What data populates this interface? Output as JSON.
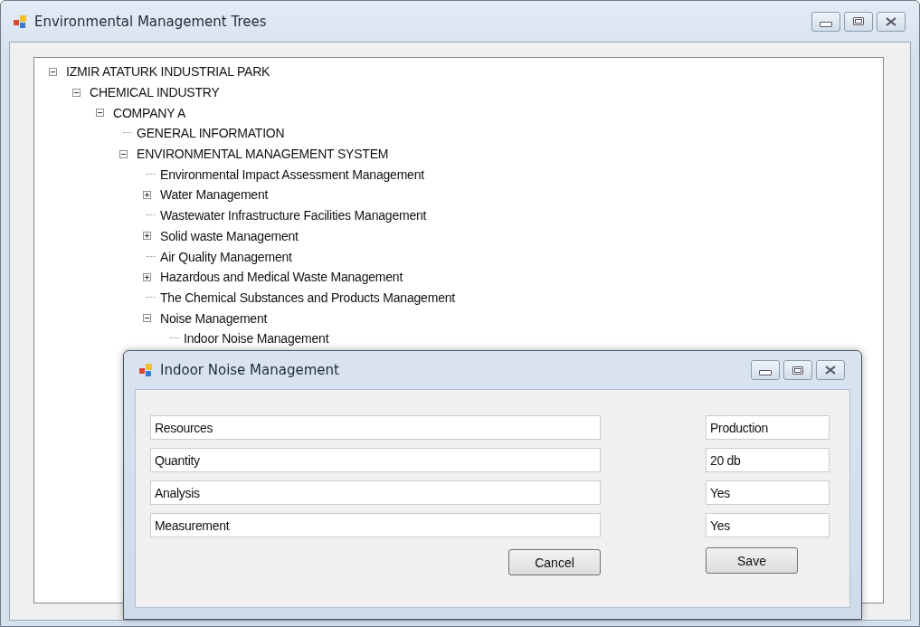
{
  "window": {
    "title": "Environmental Management Trees"
  },
  "tree": {
    "nodes": [
      {
        "label": "IZMIR ATATURK INDUSTRIAL PARK",
        "expanded": true,
        "children": [
          {
            "label": "CHEMICAL INDUSTRY",
            "expanded": true,
            "children": [
              {
                "label": "COMPANY A",
                "expanded": true,
                "children": [
                  {
                    "label": "GENERAL INFORMATION"
                  },
                  {
                    "label": "ENVIRONMENTAL MANAGEMENT SYSTEM",
                    "expanded": true,
                    "children": [
                      {
                        "label": "Environmental Impact Assessment Management"
                      },
                      {
                        "label": "Water Management",
                        "expanded": false
                      },
                      {
                        "label": "Wastewater Infrastructure Facilities Management"
                      },
                      {
                        "label": "Solid waste Management",
                        "expanded": false
                      },
                      {
                        "label": "Air Quality Management"
                      },
                      {
                        "label": "Hazardous and Medical Waste Management",
                        "expanded": false
                      },
                      {
                        "label": "The Chemical Substances and Products Management"
                      },
                      {
                        "label": "Noise Management",
                        "expanded": true,
                        "children": [
                          {
                            "label": "Indoor Noise Management"
                          }
                        ]
                      }
                    ]
                  }
                ]
              }
            ]
          }
        ]
      }
    ]
  },
  "dialog": {
    "title": "Indoor Noise Management",
    "rows": [
      {
        "label": "Resources",
        "value": "Production"
      },
      {
        "label": "Quantity",
        "value": "20 db"
      },
      {
        "label": "Analysis",
        "value": "Yes"
      },
      {
        "label": "Measurement",
        "value": "Yes"
      }
    ],
    "buttons": [
      "Cancel",
      "Save"
    ]
  }
}
